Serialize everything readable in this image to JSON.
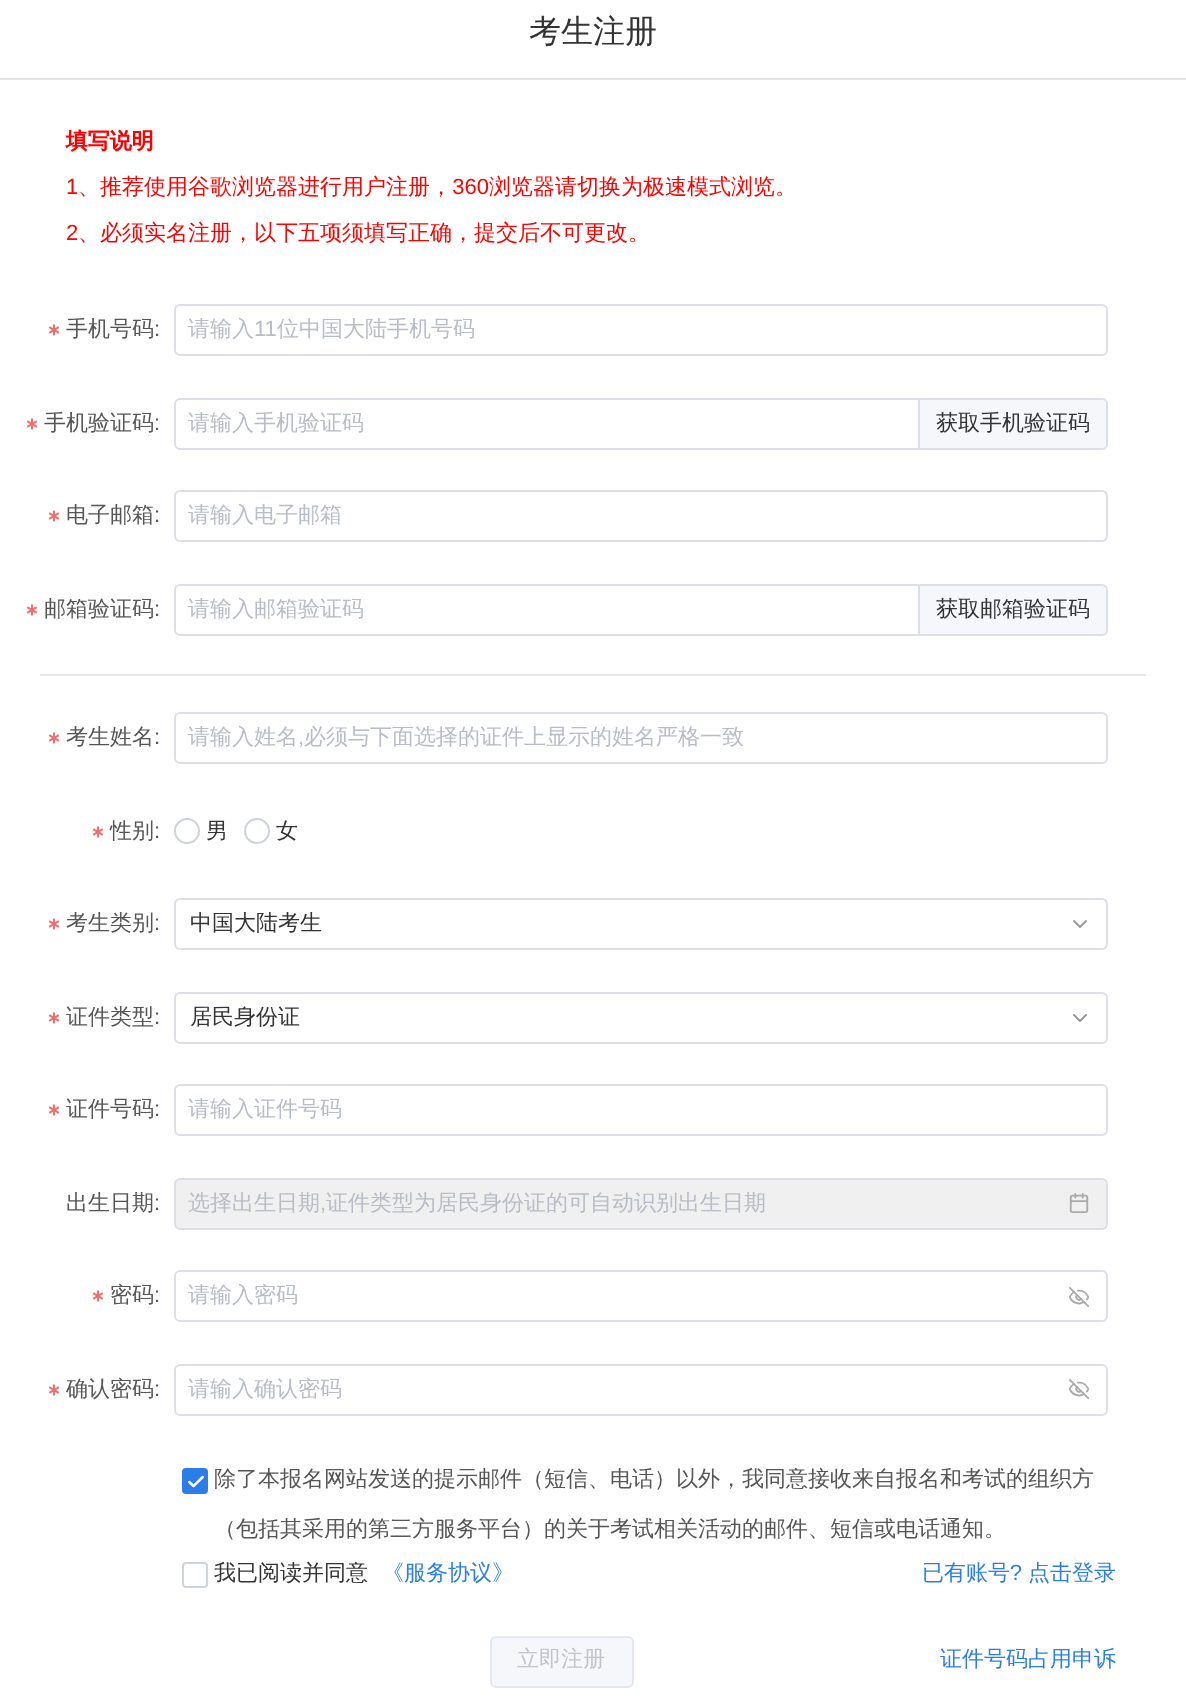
{
  "title": "考生注册",
  "notice": {
    "heading": "填写说明",
    "lines": [
      "1、推荐使用谷歌浏览器进行用户注册，360浏览器请切换为极速模式浏览。",
      "2、必须实名注册，以下五项须填写正确，提交后不可更改。"
    ]
  },
  "sections": [
    {
      "fields": [
        {
          "kind": "text",
          "label": "手机号码:",
          "required": true,
          "placeholder": "请输入11位中国大陆手机号码"
        },
        {
          "kind": "code",
          "label": "手机验证码:",
          "required": true,
          "placeholder": "请输入手机验证码",
          "button": "获取手机验证码"
        },
        {
          "kind": "text",
          "label": "电子邮箱:",
          "required": true,
          "placeholder": "请输入电子邮箱"
        },
        {
          "kind": "code",
          "label": "邮箱验证码:",
          "required": true,
          "placeholder": "请输入邮箱验证码",
          "button": "获取邮箱验证码"
        }
      ]
    },
    {
      "fields": [
        {
          "kind": "text",
          "label": "考生姓名:",
          "required": true,
          "placeholder": "请输入姓名,必须与下面选择的证件上显示的姓名严格一致"
        },
        {
          "kind": "radio",
          "label": "性别:",
          "required": true,
          "options": [
            {
              "label": "男",
              "selected": false
            },
            {
              "label": "女",
              "selected": false
            }
          ]
        },
        {
          "kind": "select",
          "label": "考生类别:",
          "required": true,
          "value": "中国大陆考生"
        },
        {
          "kind": "select",
          "label": "证件类型:",
          "required": true,
          "value": "居民身份证"
        },
        {
          "kind": "text",
          "label": "证件号码:",
          "required": true,
          "placeholder": "请输入证件号码"
        },
        {
          "kind": "date",
          "label": "出生日期:",
          "required": false,
          "disabled": true,
          "placeholder": "选择出生日期,证件类型为居民身份证的可自动识别出生日期"
        },
        {
          "kind": "password",
          "label": "密码:",
          "required": true,
          "placeholder": "请输入密码"
        },
        {
          "kind": "password",
          "label": "确认密码:",
          "required": true,
          "placeholder": "请输入确认密码"
        }
      ]
    }
  ],
  "consent": {
    "checked": true,
    "text": "除了本报名网站发送的提示邮件（短信、电话）以外，我同意接收来自报名和考试的组织方（包括其采用的第三方服务平台）的关于考试相关活动的邮件、短信或电话通知。"
  },
  "agreement": {
    "checked": false,
    "text": "我已阅读并同意",
    "link": "《服务协议》"
  },
  "login_link": "已有账号? 点击登录",
  "submit": {
    "label": "立即注册",
    "disabled": true
  },
  "appeal_link": "证件号码占用申诉"
}
